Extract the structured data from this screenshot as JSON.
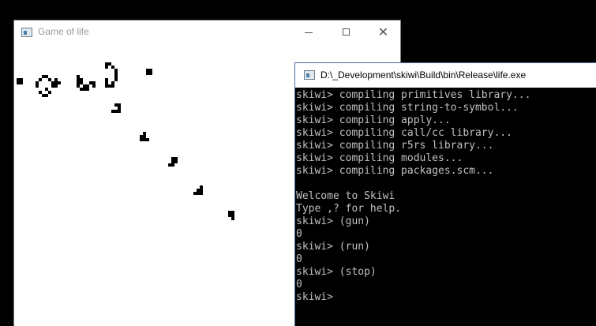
{
  "life_window": {
    "title": "Game of life",
    "icon": "console-app-icon",
    "controls": [
      "minimize-icon",
      "maximize-icon",
      "close-icon"
    ]
  },
  "console_window": {
    "title": "D:\\_Development\\skiwi\\Build\\bin\\Release\\life.exe",
    "icon": "console-app-icon",
    "lines": [
      "skiwi> compiling primitives library...",
      "skiwi> compiling string-to-symbol...",
      "skiwi> compiling apply...",
      "skiwi> compiling call/cc library...",
      "skiwi> compiling r5rs library...",
      "skiwi> compiling modules...",
      "skiwi> compiling packages.scm...",
      "",
      "Welcome to Skiwi",
      "Type ,? for help.",
      "skiwi> (gun)",
      "0",
      "skiwi> (run)",
      "0",
      "skiwi> (stop)",
      "0",
      "skiwi>"
    ]
  },
  "colors": {
    "desktop": "#000000",
    "board_background": "#ffffff",
    "live_cell": "#000000",
    "console_text": "#c0c0c0"
  }
}
